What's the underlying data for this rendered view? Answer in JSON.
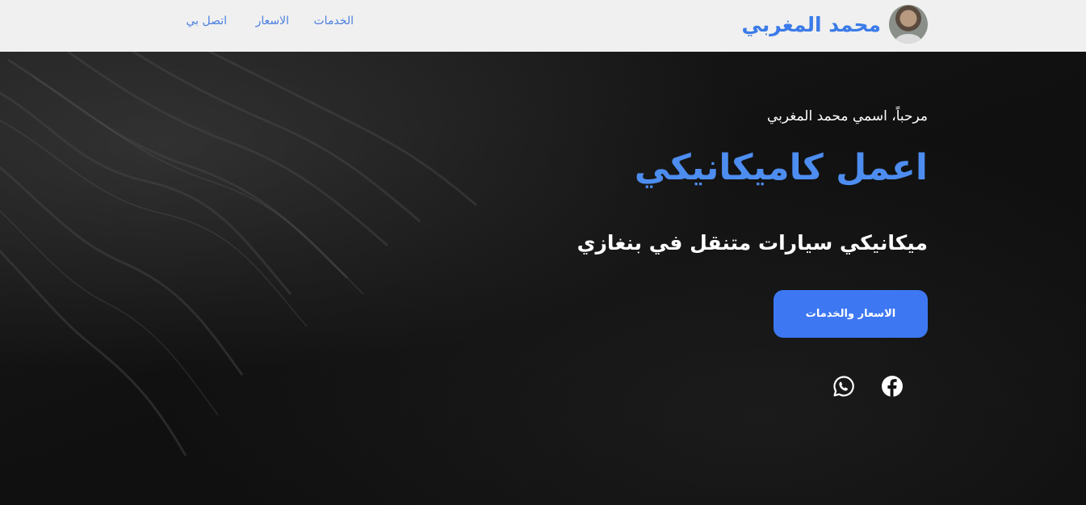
{
  "header": {
    "brand_name": "محمد المغربي",
    "nav": {
      "services": "الخدمات",
      "prices": "الاسعار",
      "contact": "اتصل بي"
    }
  },
  "hero": {
    "greeting": "مرحباً، اسمي محمد المغربي",
    "title": "اعمل كاميكانيكي",
    "subtitle": "ميكانيكي سيارات متنقل في بنغازي",
    "cta_label": "الاسعار والخدمات",
    "social": [
      "facebook-icon",
      "whatsapp-icon"
    ]
  },
  "colors": {
    "header_bg": "#f0f0f0",
    "accent": "#3d78f2",
    "title": "#4d8df0",
    "hero_bg": "#111111",
    "text_light": "#ffffff"
  }
}
